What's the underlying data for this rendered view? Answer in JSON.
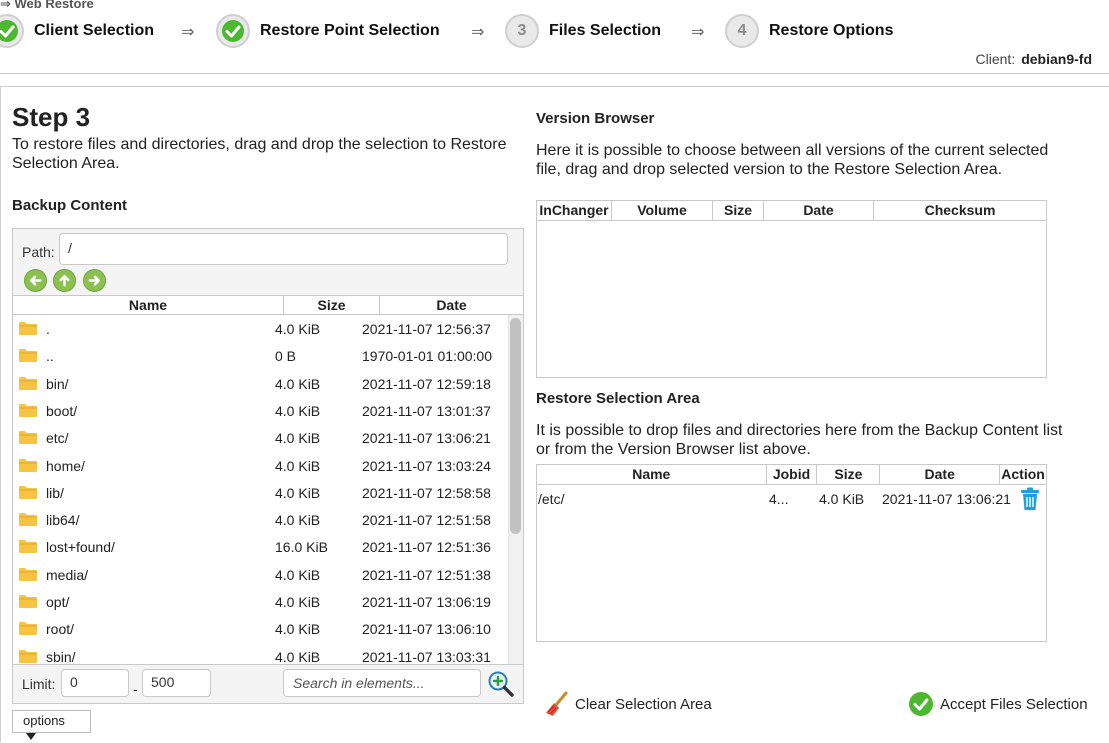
{
  "header": {
    "breadcrumb": "⇒ Web Restore",
    "steps": [
      {
        "label": "Client Selection",
        "state": "done"
      },
      {
        "label": "Restore Point Selection",
        "state": "done"
      },
      {
        "number": "3",
        "label": "Files Selection",
        "state": "current"
      },
      {
        "number": "4",
        "label": "Restore Options",
        "state": "pending"
      }
    ],
    "arrow": "⇒",
    "client_label": "Client:",
    "client_value": "debian9-fd"
  },
  "left": {
    "step_title": "Step 3",
    "description": "To restore files and directories, drag and drop the selection to Restore Selection Area.",
    "backup_content_title": "Backup Content",
    "path_label": "Path:",
    "path_value": "/",
    "nav_icons": [
      "back-arrow-icon",
      "up-arrow-icon",
      "forward-arrow-icon"
    ],
    "columns": [
      "Name",
      "Size",
      "Date"
    ],
    "files": [
      {
        "name": ".",
        "size": "4.0 KiB",
        "date": "2021-11-07 12:56:37"
      },
      {
        "name": "..",
        "size": "0 B",
        "date": "1970-01-01 01:00:00"
      },
      {
        "name": "bin/",
        "size": "4.0 KiB",
        "date": "2021-11-07 12:59:18"
      },
      {
        "name": "boot/",
        "size": "4.0 KiB",
        "date": "2021-11-07 13:01:37"
      },
      {
        "name": "etc/",
        "size": "4.0 KiB",
        "date": "2021-11-07 13:06:21"
      },
      {
        "name": "home/",
        "size": "4.0 KiB",
        "date": "2021-11-07 13:03:24"
      },
      {
        "name": "lib/",
        "size": "4.0 KiB",
        "date": "2021-11-07 12:58:58"
      },
      {
        "name": "lib64/",
        "size": "4.0 KiB",
        "date": "2021-11-07 12:51:58"
      },
      {
        "name": "lost+found/",
        "size": "16.0 KiB",
        "date": "2021-11-07 12:51:36"
      },
      {
        "name": "media/",
        "size": "4.0 KiB",
        "date": "2021-11-07 12:51:38"
      },
      {
        "name": "opt/",
        "size": "4.0 KiB",
        "date": "2021-11-07 13:06:19"
      },
      {
        "name": "root/",
        "size": "4.0 KiB",
        "date": "2021-11-07 13:06:10"
      },
      {
        "name": "sbin/",
        "size": "4.0 KiB",
        "date": "2021-11-07 13:03:31"
      }
    ],
    "limit_label": "Limit:",
    "limit_from": "0",
    "limit_dash": "-",
    "limit_to": "500",
    "search_placeholder": "Search in elements...",
    "options_label": "options"
  },
  "right": {
    "version_browser_title": "Version Browser",
    "version_browser_desc": "Here it is possible to choose between all versions of the current selected file, drag and drop selected version to the Restore Selection Area.",
    "version_columns": [
      "InChanger",
      "Volume",
      "Size",
      "Date",
      "Checksum"
    ],
    "restore_area_title": "Restore Selection Area",
    "restore_area_desc": "It is possible to drop files and directories here from the Backup Content list or from the Version Browser list above.",
    "restore_columns": [
      "Name",
      "Jobid",
      "Size",
      "Date",
      "Action"
    ],
    "restore_items": [
      {
        "name": "/etc/",
        "jobid": "4...",
        "size": "4.0 KiB",
        "date": "2021-11-07 13:06:21"
      }
    ],
    "clear_label": "Clear Selection Area",
    "accept_label": "Accept Files Selection"
  },
  "colors": {
    "accent_green": "#4cb82f",
    "nav_green": "#8cc152",
    "trash_blue": "#1ea0d8",
    "folder_yellow": "#f6c342"
  }
}
